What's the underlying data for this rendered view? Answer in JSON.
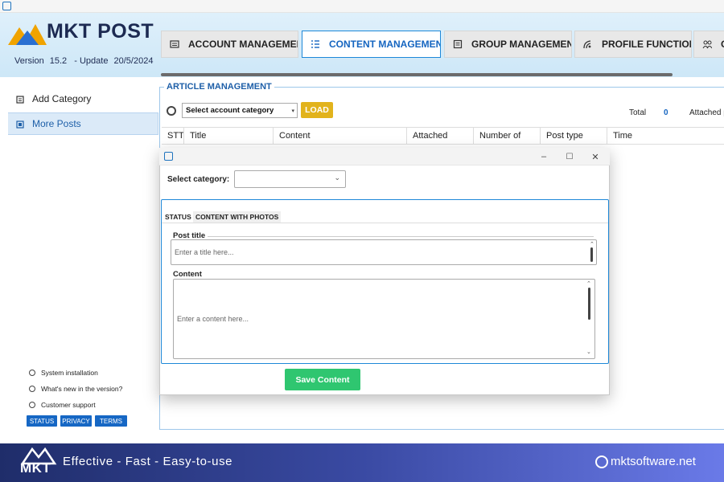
{
  "app": {
    "name": "MKT POST",
    "version_label": "Version",
    "version": "15.2",
    "update_label": "- Update",
    "update_date": "20/5/2024"
  },
  "tabs": [
    {
      "label": "ACCOUNT MANAGEMENT",
      "icon": "contact-card-icon",
      "active": false
    },
    {
      "label": "CONTENT MANAGEMENT",
      "icon": "list-icon",
      "active": true
    },
    {
      "label": "GROUP MANAGEMENT",
      "icon": "document-icon",
      "active": false
    },
    {
      "label": "PROFILE FUNCTION",
      "icon": "satellite-icon",
      "active": false
    },
    {
      "label": "G",
      "icon": "users-icon",
      "active": false
    }
  ],
  "sidebar": {
    "items": [
      {
        "label": "Add Category",
        "icon": "folder-icon",
        "active": false
      },
      {
        "label": "More Posts",
        "icon": "add-post-icon",
        "active": true
      }
    ],
    "footer_links": [
      {
        "label": "System installation",
        "icon": "gear-icon"
      },
      {
        "label": "What's new in the version?",
        "icon": "info-icon"
      },
      {
        "label": "Customer support",
        "icon": "help-icon"
      }
    ],
    "badges": [
      "STATUS",
      "PRIVACY",
      "TERMS"
    ]
  },
  "article": {
    "section_title": "ARTICLE MANAGEMENT",
    "account_select_value": "Select account category",
    "load_label": "LOAD",
    "total_label": "Total",
    "total_value": "0",
    "attached_label": "Attached p",
    "columns": [
      "STT",
      "Title",
      "Content",
      "Attached",
      "Number of",
      "Post type",
      "Time"
    ]
  },
  "dialog": {
    "select_category_label": "Select category:",
    "select_category_value": "",
    "tabs": [
      "STATUS",
      "CONTENT WITH PHOTOS"
    ],
    "active_tab": "STATUS",
    "post_title_label": "Post title",
    "post_title_placeholder": "Enter a title here...",
    "content_label": "Content",
    "content_placeholder": "Enter a content here...",
    "save_label": "Save Content",
    "window_controls": [
      "–",
      "☐",
      "✕"
    ]
  },
  "footer": {
    "logo_text": "MKT",
    "slogan": "Effective - Fast - Easy-to-use",
    "website": "mktsoftware.net"
  },
  "colors": {
    "accent": "#1e88d8",
    "load_button": "#e2b31c",
    "save_button": "#2fc670",
    "badge": "#1667c4",
    "footer_start": "#1f2d6a",
    "footer_end": "#6a7ae8"
  }
}
